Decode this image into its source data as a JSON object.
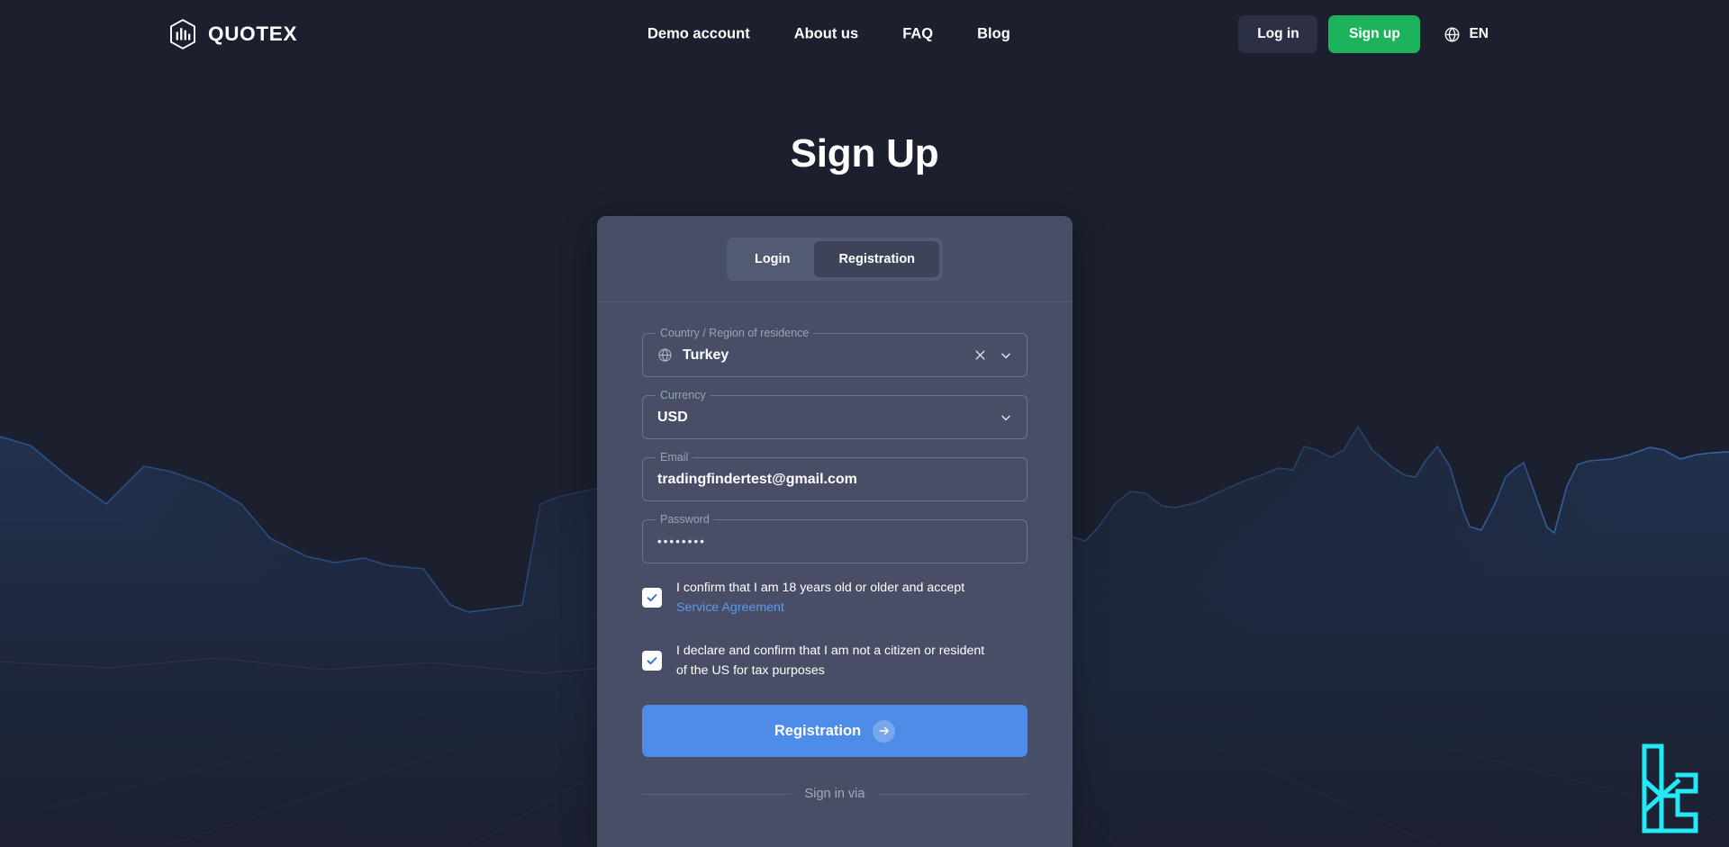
{
  "header": {
    "logo_text": "QUOTEX",
    "logo_icon": "quotex-hexagon-logo-icon",
    "nav": [
      {
        "label": "Demo account",
        "name": "nav-demo-account"
      },
      {
        "label": "About us",
        "name": "nav-about-us"
      },
      {
        "label": "FAQ",
        "name": "nav-faq"
      },
      {
        "label": "Blog",
        "name": "nav-blog"
      }
    ],
    "login_label": "Log in",
    "signup_label": "Sign up",
    "language": "EN",
    "language_icon": "globe-icon",
    "signup_color": "#1cb35c"
  },
  "page": {
    "title": "Sign Up"
  },
  "card": {
    "tabs": [
      {
        "label": "Login",
        "name": "tab-login",
        "active": false
      },
      {
        "label": "Registration",
        "name": "tab-registration",
        "active": true
      }
    ],
    "fields": {
      "country": {
        "label": "Country / Region of residence",
        "value": "Turkey",
        "left_icon": "globe-icon",
        "clear_icon": "close-icon",
        "expand_icon": "chevron-down-icon"
      },
      "currency": {
        "label": "Currency",
        "value": "USD",
        "expand_icon": "chevron-down-icon"
      },
      "email": {
        "label": "Email",
        "value": "tradingfindertest@gmail.com",
        "placeholder": "Email"
      },
      "password": {
        "label": "Password",
        "value": "••••••••",
        "placeholder": "Password"
      }
    },
    "checkboxes": [
      {
        "name": "checkbox-age-confirmation",
        "checked": true,
        "text": "I confirm that I am 18 years old or older and accept",
        "link_text": "Service Agreement"
      },
      {
        "name": "checkbox-us-citizen-declaration",
        "checked": true,
        "text": "I declare and confirm that I am not a citizen or resident of the US for tax purposes",
        "link_text": ""
      }
    ],
    "submit": {
      "label": "Registration",
      "icon": "arrow-right-icon",
      "color": "#4f8ce9"
    },
    "divider_text": "Sign in via"
  },
  "watermark": {
    "name": "tradingfinder-watermark-logo",
    "color": "#22e9f5"
  },
  "theme": {
    "page_bg": "#1b1f2e",
    "card_bg": "#474e66",
    "accent_blue": "#4f8ce9",
    "link_blue": "#5b9bf0",
    "green": "#1cb35c",
    "chart_line": "#2f5d9e"
  }
}
